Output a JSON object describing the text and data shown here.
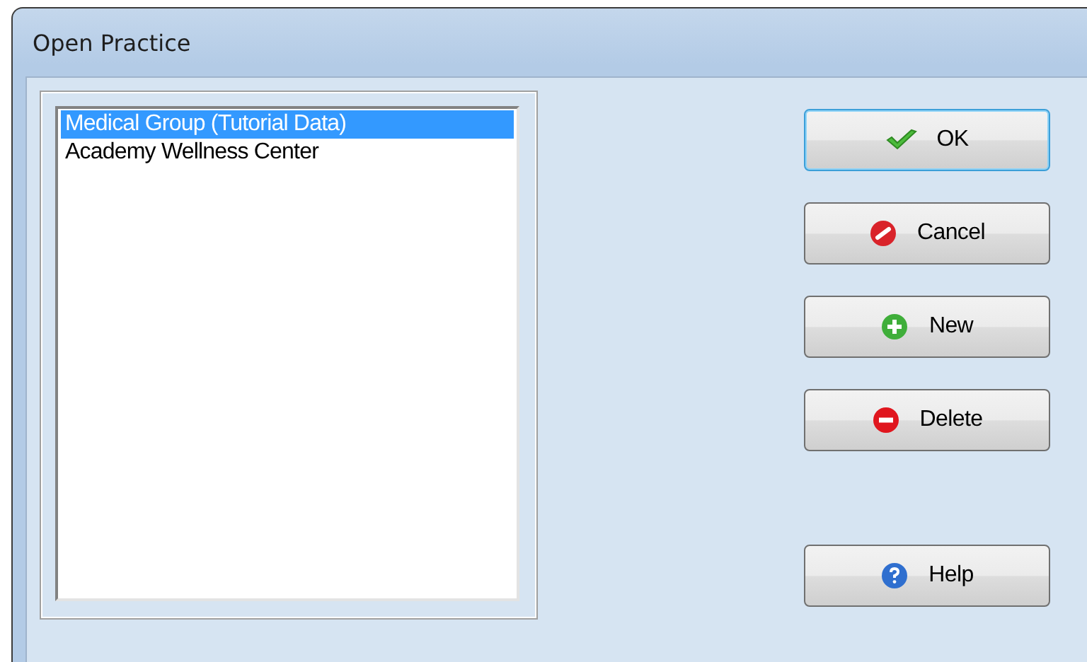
{
  "window": {
    "title": "Open Practice"
  },
  "practices": [
    {
      "name": "Medical Group (Tutorial Data)",
      "selected": true
    },
    {
      "name": "Academy Wellness Center",
      "selected": false
    }
  ],
  "buttons": [
    {
      "label": "OK",
      "kind": "ok",
      "default": true
    },
    {
      "label": "Cancel",
      "kind": "cancel",
      "default": false
    },
    {
      "label": "New",
      "kind": "new",
      "default": false
    },
    {
      "label": "Delete",
      "kind": "delete",
      "default": false
    },
    {
      "label": "Help",
      "kind": "help",
      "default": false
    }
  ]
}
